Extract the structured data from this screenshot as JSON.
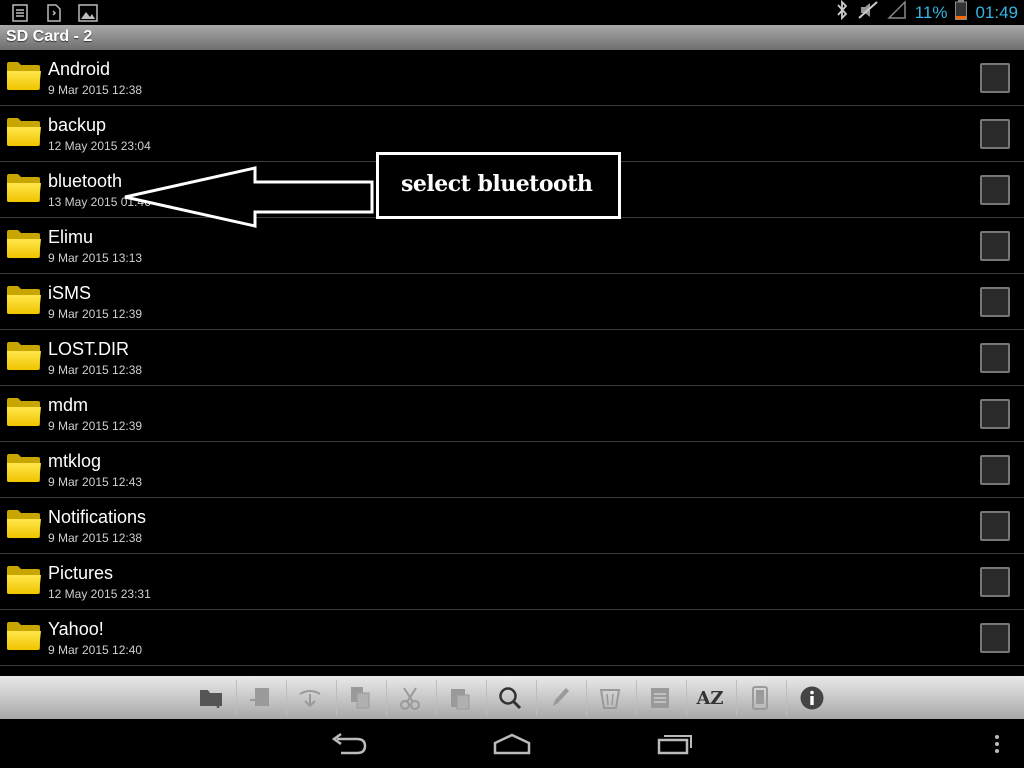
{
  "statusbar": {
    "battery_percent": "11%",
    "time": "01:49",
    "accent_color": "#33b5e5",
    "icons": [
      "task-icon",
      "file-icon",
      "image-icon",
      "bluetooth-icon",
      "mute-icon",
      "signal-icon",
      "battery-icon"
    ]
  },
  "title": "SD Card - 2",
  "files": [
    {
      "name": "Android",
      "date": "9 Mar 2015 12:38"
    },
    {
      "name": "backup",
      "date": "12 May 2015 23:04"
    },
    {
      "name": "bluetooth",
      "date": "13 May 2015 01:46"
    },
    {
      "name": "Elimu",
      "date": "9 Mar 2015 13:13"
    },
    {
      "name": "iSMS",
      "date": "9 Mar 2015 12:39"
    },
    {
      "name": "LOST.DIR",
      "date": "9 Mar 2015 12:38"
    },
    {
      "name": "mdm",
      "date": "9 Mar 2015 12:39"
    },
    {
      "name": "mtklog",
      "date": "9 Mar 2015 12:43"
    },
    {
      "name": "Notifications",
      "date": "9 Mar 2015 12:38"
    },
    {
      "name": "Pictures",
      "date": "12 May 2015 23:31"
    },
    {
      "name": "Yahoo!",
      "date": "9 Mar 2015 12:40"
    }
  ],
  "annotation": {
    "text": "select bluetooth"
  },
  "toolbar": {
    "buttons": [
      "new-folder-icon",
      "move-icon",
      "share-icon",
      "copy-icon",
      "cut-icon",
      "paste-icon",
      "search-icon",
      "rename-icon",
      "delete-icon",
      "zip-icon",
      "sort-az-icon",
      "phone-icon",
      "info-icon"
    ],
    "sort_label": "AZ"
  },
  "navbar": {
    "buttons": [
      "back-icon",
      "home-icon",
      "recent-apps-icon",
      "menu-icon"
    ]
  }
}
